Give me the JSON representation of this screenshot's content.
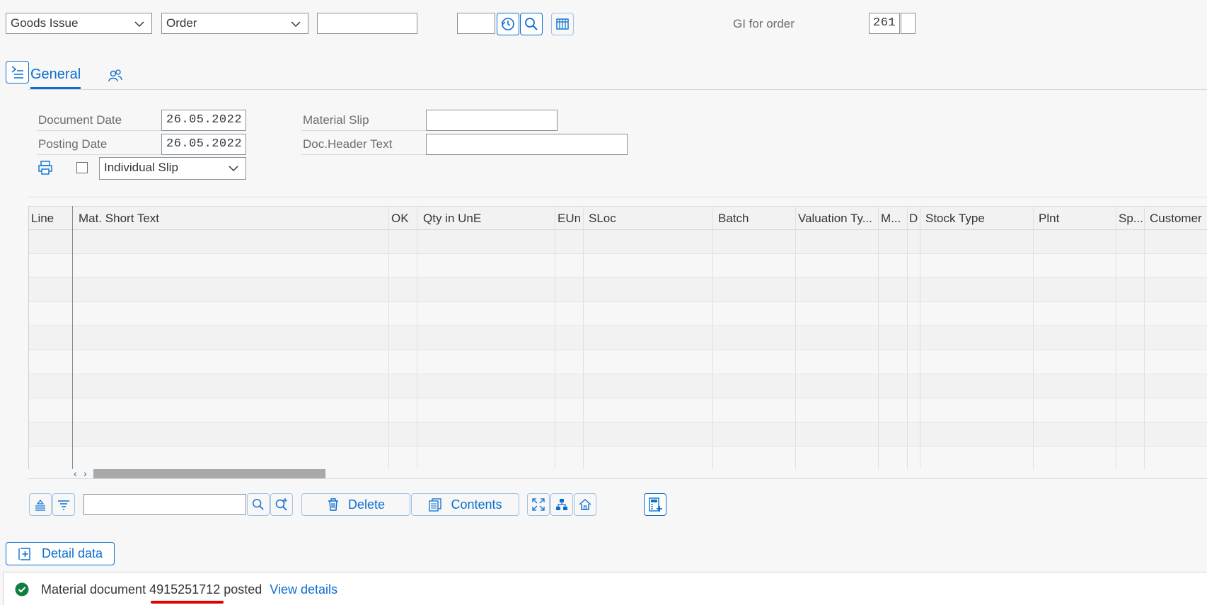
{
  "toolbar": {
    "action_value": "Goods Issue",
    "reference_value": "Order",
    "reference_number_value": "",
    "small_input_value": "",
    "gi_label": "GI for order",
    "movement_type_value": "261",
    "movement_type_extra": ""
  },
  "tabs": {
    "general_label": "General"
  },
  "header_form": {
    "document_date_label": "Document Date",
    "document_date_value": "26.05.2022",
    "posting_date_label": "Posting Date",
    "posting_date_value": "26.05.2022",
    "material_slip_label": "Material Slip",
    "material_slip_value": "",
    "doc_header_text_label": "Doc.Header Text",
    "doc_header_text_value": "",
    "print_option_value": "Individual Slip"
  },
  "table": {
    "columns": [
      "Line",
      "Mat. Short Text",
      "OK",
      "Qty in UnE",
      "EUn",
      "SLoc",
      "Batch",
      "Valuation Ty...",
      "M...",
      "D",
      "Stock Type",
      "Plnt",
      "Sp...",
      "Customer"
    ],
    "rows": []
  },
  "bottom_toolbar": {
    "search_value": "",
    "delete_label": "Delete",
    "contents_label": "Contents"
  },
  "detail_data_label": "Detail data",
  "message": {
    "prefix": "Material document",
    "doc_number": "4915251712",
    "suffix": "posted",
    "link": "View details",
    "status": "success"
  },
  "colors": {
    "accent": "#0a6ed1",
    "success": "#107e3e",
    "highlight_underline": "#e00000"
  }
}
